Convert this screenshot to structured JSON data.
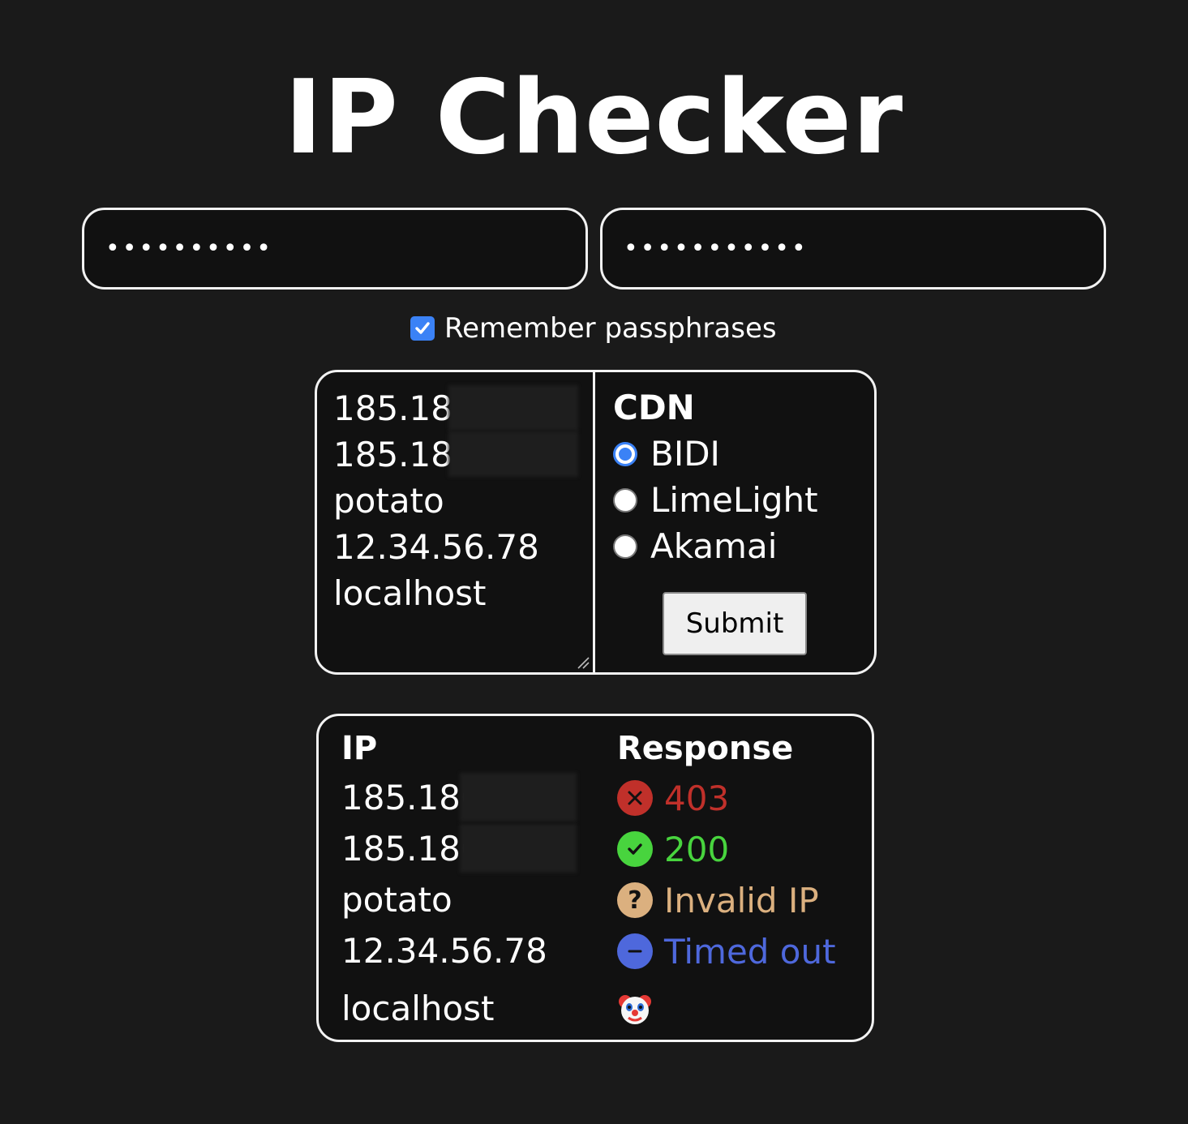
{
  "page": {
    "title": "IP Checker"
  },
  "passphrases": {
    "first_value": "••••••••••",
    "second_value": "•••••••••••"
  },
  "remember": {
    "label": "Remember passphrases",
    "checked": true
  },
  "ip_input": {
    "lines": [
      "185.186",
      "185.186",
      "potato",
      "12.34.56.78",
      "localhost"
    ]
  },
  "cdn": {
    "title": "CDN",
    "options": [
      {
        "label": "BIDI",
        "selected": true
      },
      {
        "label": "LimeLight",
        "selected": false
      },
      {
        "label": "Akamai",
        "selected": false
      }
    ]
  },
  "submit": {
    "label": "Submit"
  },
  "results": {
    "headers": {
      "ip": "IP",
      "response": "Response"
    },
    "rows": [
      {
        "ip": "185.186.",
        "response": "403",
        "icon": "error-x-icon",
        "color": "#c0302a"
      },
      {
        "ip": "185.186.",
        "response": "200",
        "icon": "success-check-icon",
        "color": "#48d43e"
      },
      {
        "ip": "potato",
        "response": "Invalid IP",
        "icon": "question-icon",
        "color": "#dbb07f"
      },
      {
        "ip": "12.34.56.78",
        "response": "Timed out",
        "icon": "minus-icon",
        "color": "#4e68dc"
      },
      {
        "ip": "localhost",
        "response": "",
        "icon": "clown-face-icon",
        "color": "#ffffff"
      }
    ]
  }
}
